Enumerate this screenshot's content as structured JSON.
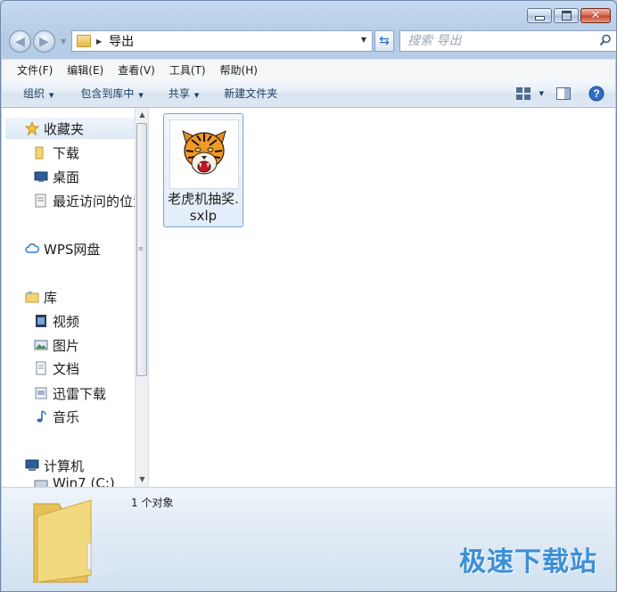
{
  "window": {
    "buttons": {
      "minimize": "minimize",
      "maximize": "maximize",
      "close": "close"
    }
  },
  "address": {
    "crumb": "导出"
  },
  "search": {
    "placeholder": "搜索 导出"
  },
  "menu": [
    "文件(F)",
    "编辑(E)",
    "查看(V)",
    "工具(T)",
    "帮助(H)"
  ],
  "commands": {
    "organize": "组织",
    "include_library": "包含到库中",
    "share": "共享",
    "new_folder": "新建文件夹"
  },
  "nav": {
    "favorites": "收藏夹",
    "downloads": "下载",
    "desktop": "桌面",
    "recent": "最近访问的位置",
    "wps": "WPS网盘",
    "libraries": "库",
    "videos": "视频",
    "pictures": "图片",
    "documents": "文档",
    "thunder": "迅雷下载",
    "music": "音乐",
    "computer": "计算机",
    "drive": "Win7 (C:)"
  },
  "file": {
    "name": "老虎机抽奖.sxlp"
  },
  "details": {
    "count": "1 个对象"
  },
  "watermark": "极速下载站",
  "colors": {
    "accent": "#3d8fd6",
    "selection": "#7da2ce",
    "chrome": "#bcd3ec"
  }
}
